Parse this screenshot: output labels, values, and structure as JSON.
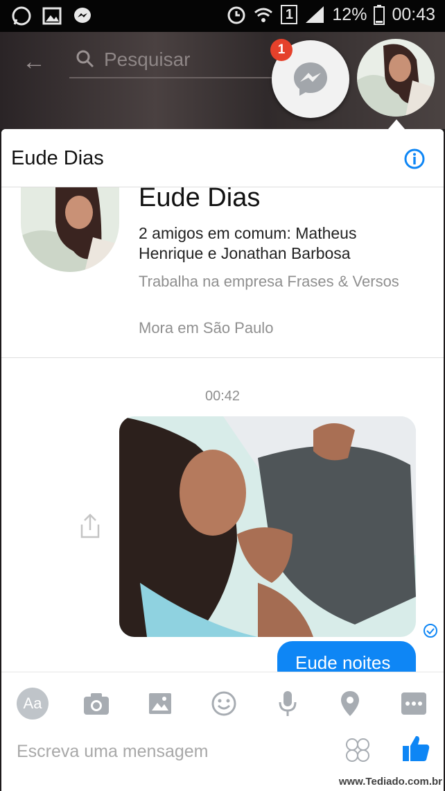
{
  "status_bar": {
    "battery": "12%",
    "time": "00:43",
    "sim": "1"
  },
  "background": {
    "search_placeholder": "Pesquisar"
  },
  "chat_heads": {
    "badge_count": "1"
  },
  "chat": {
    "title": "Eude Dias",
    "profile": {
      "name": "Eude Dias",
      "mutual_friends": "2 amigos em comum: Matheus Henrique e Jonathan Barbosa",
      "work": "Trabalha na empresa Frases & Versos",
      "city": "Mora em São Paulo"
    },
    "timestamp": "00:42",
    "messages": [
      {
        "type": "photo"
      },
      {
        "type": "text",
        "text": "Eude noites"
      }
    ]
  },
  "composer": {
    "placeholder": "Escreva uma mensagem",
    "aa_label": "Aa"
  },
  "watermark": "www.Tediado.com.br",
  "colors": {
    "accent": "#0e86f5",
    "badge": "#e5412b"
  }
}
